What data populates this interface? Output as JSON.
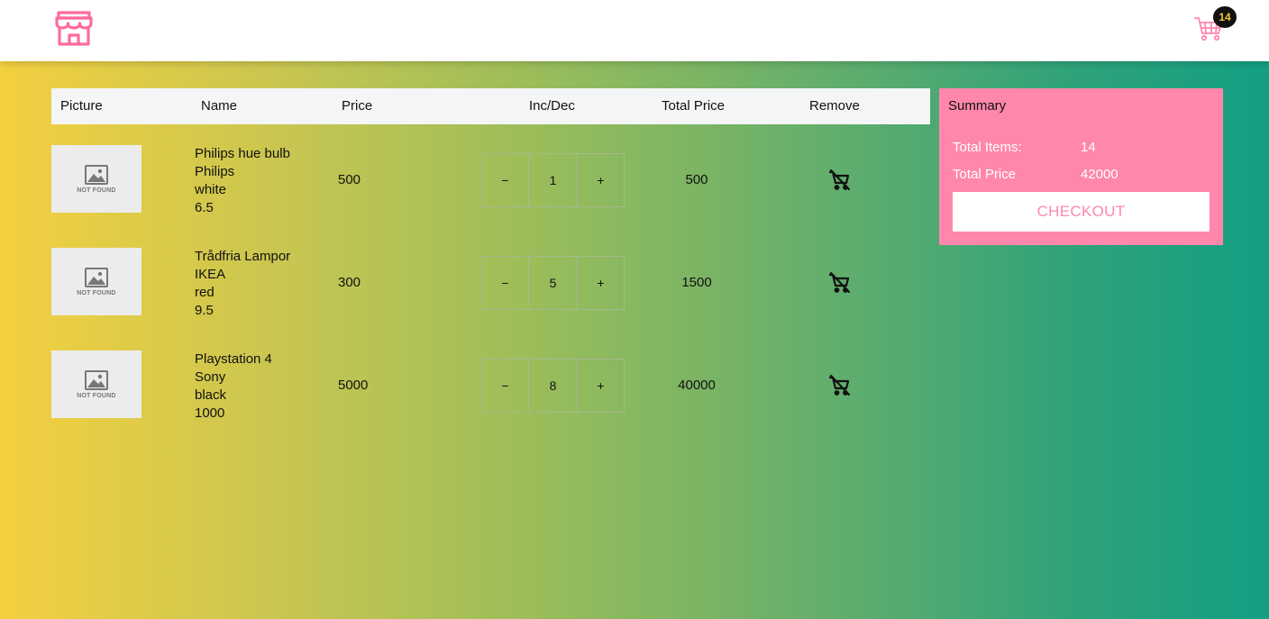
{
  "header": {
    "logo_icon": "store-icon",
    "cart_icon": "shopping-cart-icon",
    "cart_count": "14",
    "brand_color": "#ff6b9a",
    "badge_text_color": "#f4c430"
  },
  "table": {
    "headers": [
      "Picture",
      "Name",
      "Price",
      "Inc/Dec",
      "Total Price",
      "Remove"
    ],
    "placeholder_text": "NOT FOUND",
    "dec_label": "−",
    "inc_label": "+",
    "remove_icon": "remove-from-cart-icon",
    "rows": [
      {
        "name": "Philips hue bulb",
        "brand": "Philips",
        "color": "white",
        "rating": "6.5",
        "price": "500",
        "qty": "1",
        "total": "500"
      },
      {
        "name": "Trådfria Lampor",
        "brand": "IKEA",
        "color": "red",
        "rating": "9.5",
        "price": "300",
        "qty": "5",
        "total": "1500"
      },
      {
        "name": "Playstation 4",
        "brand": "Sony",
        "color": "black",
        "rating": "1000",
        "price": "5000",
        "qty": "8",
        "total": "40000"
      }
    ]
  },
  "summary": {
    "title": "Summary",
    "total_items_label": "Total Items:",
    "total_items_value": "14",
    "total_price_label": "Total Price",
    "total_price_value": "42000",
    "checkout_label": "CHECKOUT",
    "background_color": "#ff87ac"
  }
}
